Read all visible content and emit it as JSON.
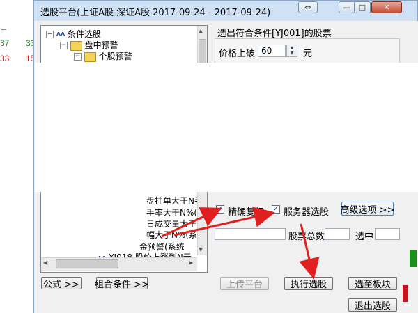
{
  "window": {
    "title": "选股平台(上证A股 深证A股  2017-09-24 - 2017-09-24)",
    "buttons": {
      "restore": "⇔",
      "minimize": "—",
      "maximize": "□",
      "close": "✕"
    }
  },
  "background": {
    "dash": "–",
    "row1": [
      "37",
      "33"
    ],
    "row2": [
      "33",
      "15"
    ]
  },
  "tree": {
    "items": [
      {
        "label": "条件选股"
      },
      {
        "label": "盘中预警"
      },
      {
        "label": "个股预警"
      }
    ],
    "partial_items": [
      "盘挂单大于N手",
      "手率大于N%(系",
      "日成交量大于",
      "幅大于N%(系统",
      "金预警(系统",
      "YJ018  股价上涨到N元"
    ],
    "bottom_icon": "AA"
  },
  "panel": {
    "title": "选出符合条件[YJ001]的股票",
    "param_label": "价格上破",
    "param_value": "60",
    "param_unit": "元"
  },
  "options": {
    "exact_reinstatement": {
      "label": "精确复权",
      "checked": true
    },
    "server_select": {
      "label": "服务器选股",
      "checked": true
    },
    "advanced_button": "高级选项 >>",
    "stock_total_label": "股票总数",
    "selected_label": "选中"
  },
  "buttons": {
    "formula": "公式 >>",
    "combined_condition": "组合条件 >>",
    "upload_platform": "上传平台",
    "execute_select": "执行选股",
    "save_to_block": "选至板块",
    "exit_select": "退出选股"
  },
  "colors": {
    "green_num": "#1a8f1a",
    "red_num": "#c8141e",
    "arrow": "#e0201e"
  }
}
